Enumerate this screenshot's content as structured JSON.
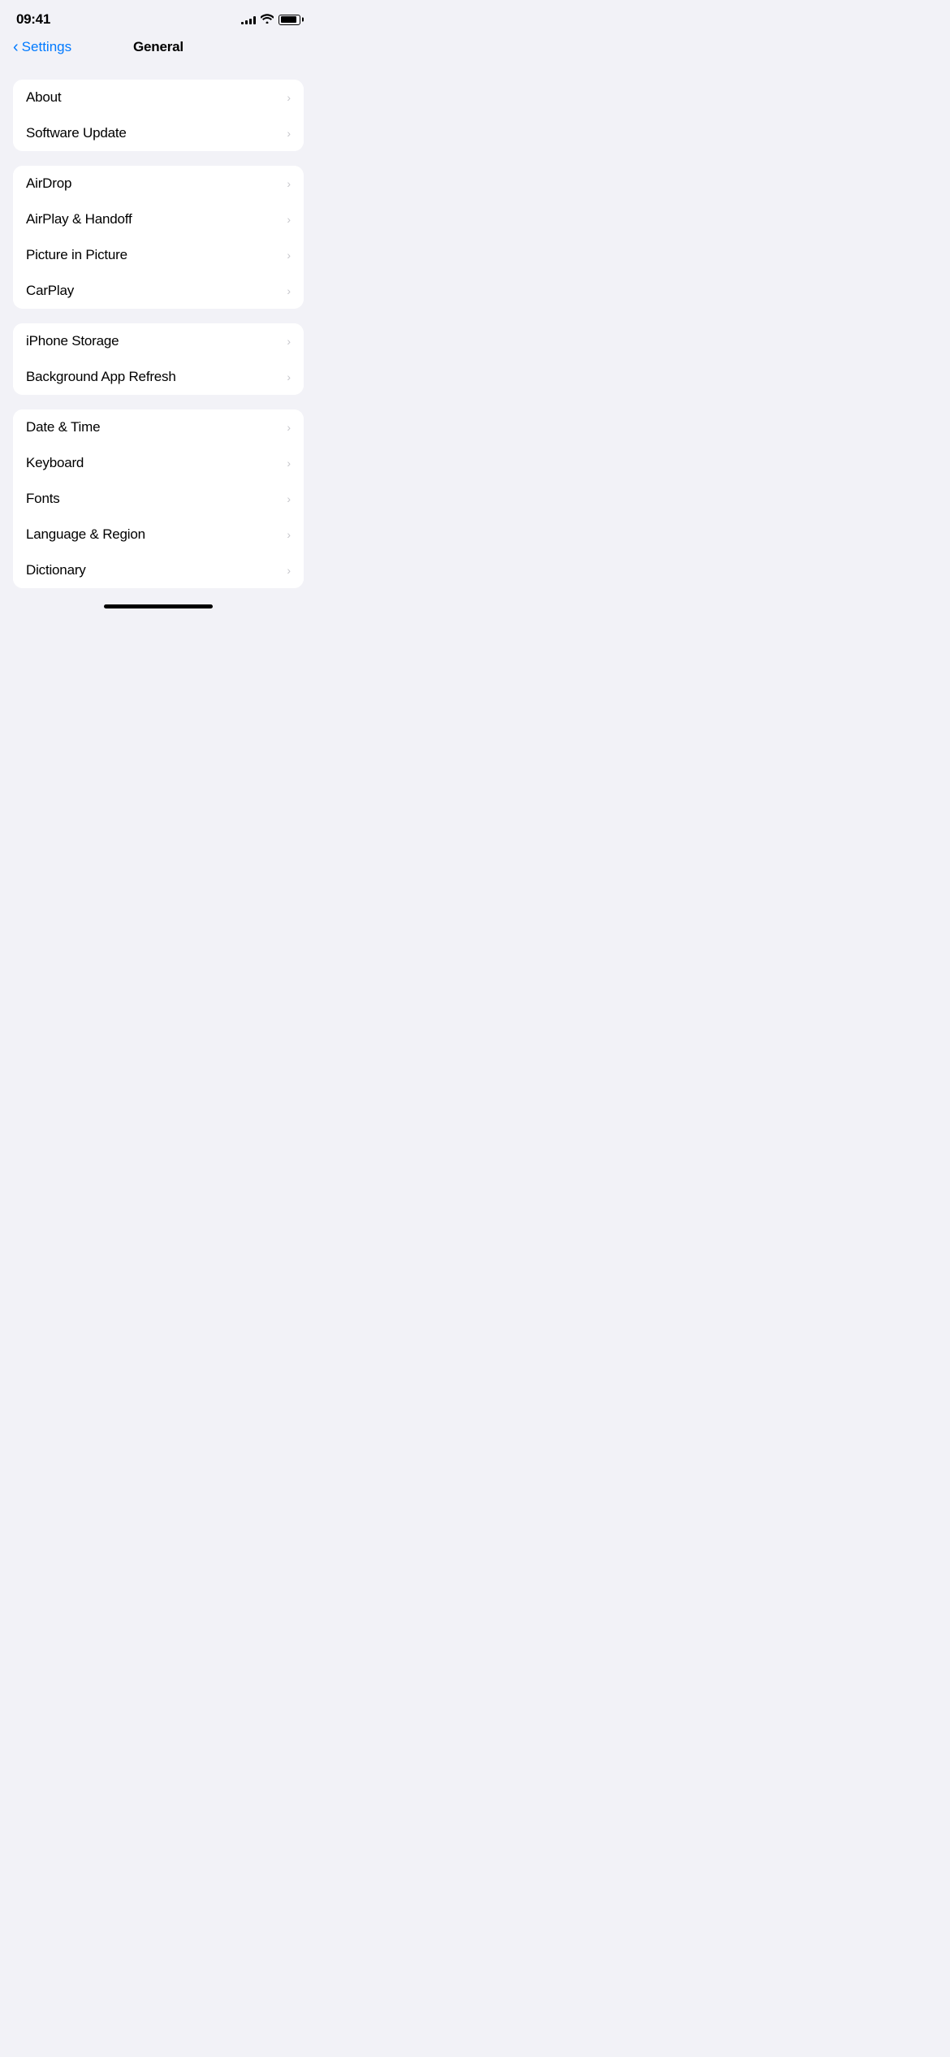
{
  "status": {
    "time": "09:41",
    "signal_bars": [
      3,
      5,
      7,
      9,
      11
    ],
    "wifi": "wifi",
    "battery": 90
  },
  "header": {
    "back_label": "Settings",
    "title": "General"
  },
  "sections": [
    {
      "id": "section-1",
      "items": [
        {
          "id": "about",
          "label": "About"
        },
        {
          "id": "software-update",
          "label": "Software Update"
        }
      ]
    },
    {
      "id": "section-2",
      "items": [
        {
          "id": "airdrop",
          "label": "AirDrop"
        },
        {
          "id": "airplay-handoff",
          "label": "AirPlay & Handoff"
        },
        {
          "id": "picture-in-picture",
          "label": "Picture in Picture"
        },
        {
          "id": "carplay",
          "label": "CarPlay"
        }
      ]
    },
    {
      "id": "section-3",
      "items": [
        {
          "id": "iphone-storage",
          "label": "iPhone Storage"
        },
        {
          "id": "background-app-refresh",
          "label": "Background App Refresh"
        }
      ]
    },
    {
      "id": "section-4",
      "items": [
        {
          "id": "date-time",
          "label": "Date & Time"
        },
        {
          "id": "keyboard",
          "label": "Keyboard"
        },
        {
          "id": "fonts",
          "label": "Fonts"
        },
        {
          "id": "language-region",
          "label": "Language & Region"
        },
        {
          "id": "dictionary",
          "label": "Dictionary"
        }
      ]
    }
  ],
  "home_indicator": true
}
